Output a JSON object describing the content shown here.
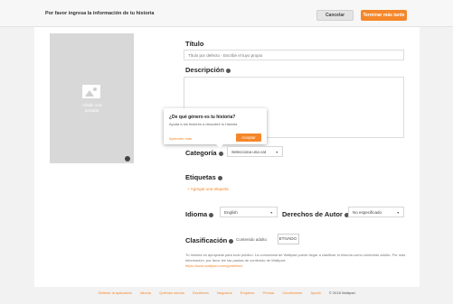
{
  "header": {
    "title": "Por favor ingresa la información de tu historia",
    "cancel_label": "Cancelar",
    "later_label": "Terminar más tarde"
  },
  "cover": {
    "label": "Añadir una\nportada",
    "icon": "image-icon"
  },
  "form": {
    "title_label": "Título",
    "title_placeholder": "Título por defecto - Escribe el tuyo propio",
    "description_label": "Descripción",
    "category_label": "Categoría",
    "category_value": "Selecciona una cat",
    "tags_label": "Etiquetas",
    "add_tag_label": "+ Agregar una etiqueta",
    "language_label": "Idioma",
    "language_value": "English",
    "copyright_label": "Derechos de Autor",
    "copyright_value": "No especificado",
    "rating_label": "Clasificación",
    "mature_label": "Contenido adulto",
    "toggle_state": "ETIVADO",
    "help_text": "Tu historia es apropiada para todo público. La comunidad de Wattpad puede llegar a clasificar tu historia como contenido adulto. Por más información, por favor lee las pautas de contenido de Wattpad:",
    "help_url": "https://www.wattpad.com/guidelines"
  },
  "tooltip": {
    "title": "¿De qué género es tu historia?",
    "body": "Ayuda a los lectores a descubrir tu historia",
    "learn_more": "Aprender más",
    "accept_label": "Aceptar"
  },
  "footer": {
    "links": [
      "Obtener la aplicación",
      "Idioma",
      "Quiénes somos",
      "Escritores",
      "Negocios",
      "Empleos",
      "Prensa",
      "Condiciones",
      "Ayuda"
    ],
    "copyright": "© 2018 Wattpad"
  },
  "colors": {
    "accent": "#f5862a",
    "background": "#f2f2f2"
  }
}
